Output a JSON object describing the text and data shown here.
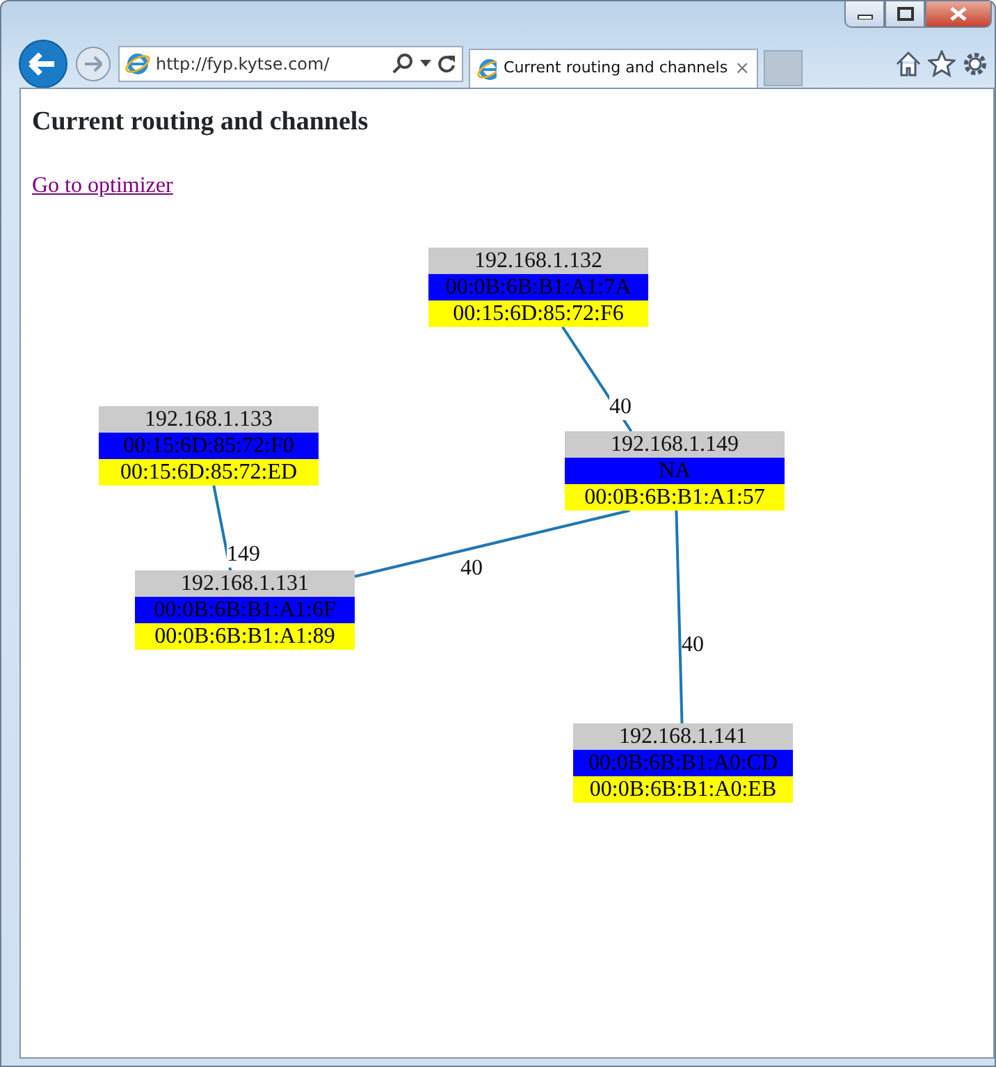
{
  "browser": {
    "url": "http://fyp.kytse.com/",
    "tab": {
      "title": "Current routing and channels",
      "close": "×"
    }
  },
  "page": {
    "heading": "Current routing and channels",
    "link": "Go to optimizer"
  },
  "graph": {
    "nodes": [
      {
        "ip": "192.168.1.132",
        "mac_1": "00:0B:6B:B1:A1:7A",
        "mac_2": "00:15:6D:85:72:F6"
      },
      {
        "ip": "192.168.1.133",
        "mac_1": "00:15:6D:85:72:F0",
        "mac_2": "00:15:6D:85:72:ED"
      },
      {
        "ip": "192.168.1.149",
        "mac_1": "NA",
        "mac_2": "00:0B:6B:B1:A1:57"
      },
      {
        "ip": "192.168.1.131",
        "mac_1": "00:0B:6B:B1:A1:6F",
        "mac_2": "00:0B:6B:B1:A1:89"
      },
      {
        "ip": "192.168.1.141",
        "mac_1": "00:0B:6B:B1:A0:CD",
        "mac_2": "00:0B:6B:B1:A0:EB"
      }
    ],
    "edges": [
      {
        "label": "40"
      },
      {
        "label": "149"
      },
      {
        "label": "40"
      },
      {
        "label": "40"
      }
    ]
  }
}
